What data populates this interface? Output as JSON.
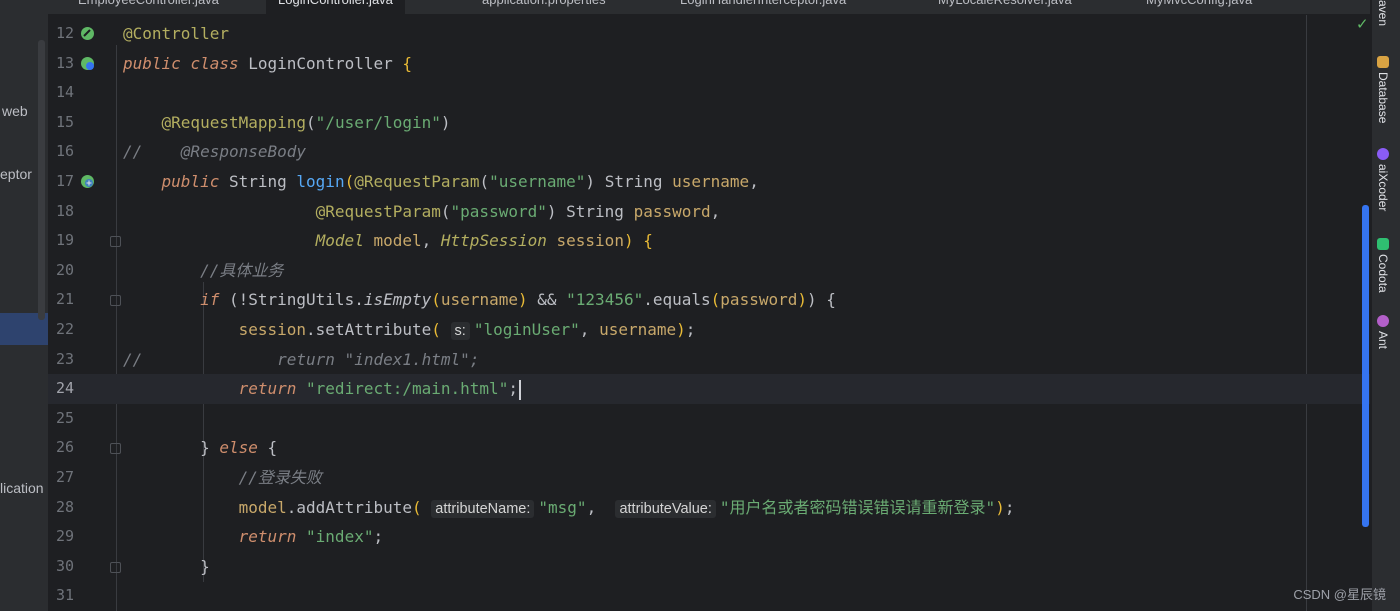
{
  "project_panel": {
    "items": [
      "web",
      "eptor",
      "lication"
    ]
  },
  "tabs": [
    {
      "label": "EmployeeController.java",
      "active": false
    },
    {
      "label": "LoginController.java",
      "active": true
    },
    {
      "label": "application.properties",
      "active": false
    },
    {
      "label": "LoginHandlerInterceptor.java",
      "active": false
    },
    {
      "label": "MyLocaleResolver.java",
      "active": false
    },
    {
      "label": "MyMvcConfig.java",
      "active": false
    }
  ],
  "editor": {
    "current_line": "24",
    "lines": [
      {
        "n": "12",
        "icon": "spring-bean-icon"
      },
      {
        "n": "13",
        "icon": "spring-web-icon"
      },
      {
        "n": "14"
      },
      {
        "n": "15"
      },
      {
        "n": "16"
      },
      {
        "n": "17",
        "icon": "request-mapping-icon"
      },
      {
        "n": "18"
      },
      {
        "n": "19",
        "fold": true
      },
      {
        "n": "20"
      },
      {
        "n": "21",
        "fold": true
      },
      {
        "n": "22"
      },
      {
        "n": "23"
      },
      {
        "n": "24"
      },
      {
        "n": "25"
      },
      {
        "n": "26",
        "fold": true
      },
      {
        "n": "27"
      },
      {
        "n": "28"
      },
      {
        "n": "29"
      },
      {
        "n": "30",
        "fold": true
      },
      {
        "n": "31"
      }
    ],
    "code": {
      "l12_ann": "@Controller",
      "l13_kw1": "public",
      "l13_kw2": "class",
      "l13_name": "LoginController",
      "l13_brace": " {",
      "l15_ann": "@RequestMapping",
      "l15_str": "\"/user/login\"",
      "l16_slashes": "//",
      "l16_ann": "@ResponseBody",
      "l17_kw": "public",
      "l17_type": "String",
      "l17_method": "login",
      "l17_ann": "@RequestParam",
      "l17_str": "\"username\"",
      "l17_type2": "String",
      "l17_param": "username",
      "l18_ann": "@RequestParam",
      "l18_str": "\"password\"",
      "l18_type": "String",
      "l18_param": "password",
      "l19_type1": "Model",
      "l19_p1": "model",
      "l19_type2": "HttpSession",
      "l19_p2": "session",
      "l20_cmt": "//具体业务",
      "l21_kw": "if",
      "l21_cls": "StringUtils",
      "l21_m": "isEmpty",
      "l21_arg": "username",
      "l21_str": "\"123456\"",
      "l21_m2": "equals",
      "l21_arg2": "password",
      "l22_obj": "session",
      "l22_m": "setAttribute",
      "l22_hint": "s:",
      "l22_str": "\"loginUser\"",
      "l22_arg": "username",
      "l23_slashes": "//",
      "l23_text": "return \"index1.html\";",
      "l24_kw": "return",
      "l24_str": "\"redirect:/main.html\"",
      "l26_close": "}",
      "l26_kw": "else",
      "l26_brace": "{",
      "l27_cmt": "//登录失败",
      "l28_obj": "model",
      "l28_m": "addAttribute",
      "l28_hint1": "attributeName:",
      "l28_str1": "\"msg\"",
      "l28_hint2": "attributeValue:",
      "l28_str2": "\"用户名或者密码错误错误请重新登录\"",
      "l29_kw": "return",
      "l29_str": "\"index\"",
      "l30_close": "}"
    }
  },
  "right_tools": [
    {
      "label": "Maven",
      "icon": "maven-icon"
    },
    {
      "label": "Database",
      "icon": "database-icon"
    },
    {
      "label": "aiXcoder",
      "icon": "aixcoder-icon"
    },
    {
      "label": "Codota",
      "icon": "codota-icon"
    },
    {
      "label": "Ant",
      "icon": "ant-icon"
    }
  ],
  "watermark": "CSDN @星辰镜",
  "colors": {
    "background": "#1e1f22",
    "keyword": "#cf8e6d",
    "annotation": "#b3ae60",
    "string": "#6aab73",
    "comment": "#7a7e85",
    "accent": "#3574f0"
  }
}
